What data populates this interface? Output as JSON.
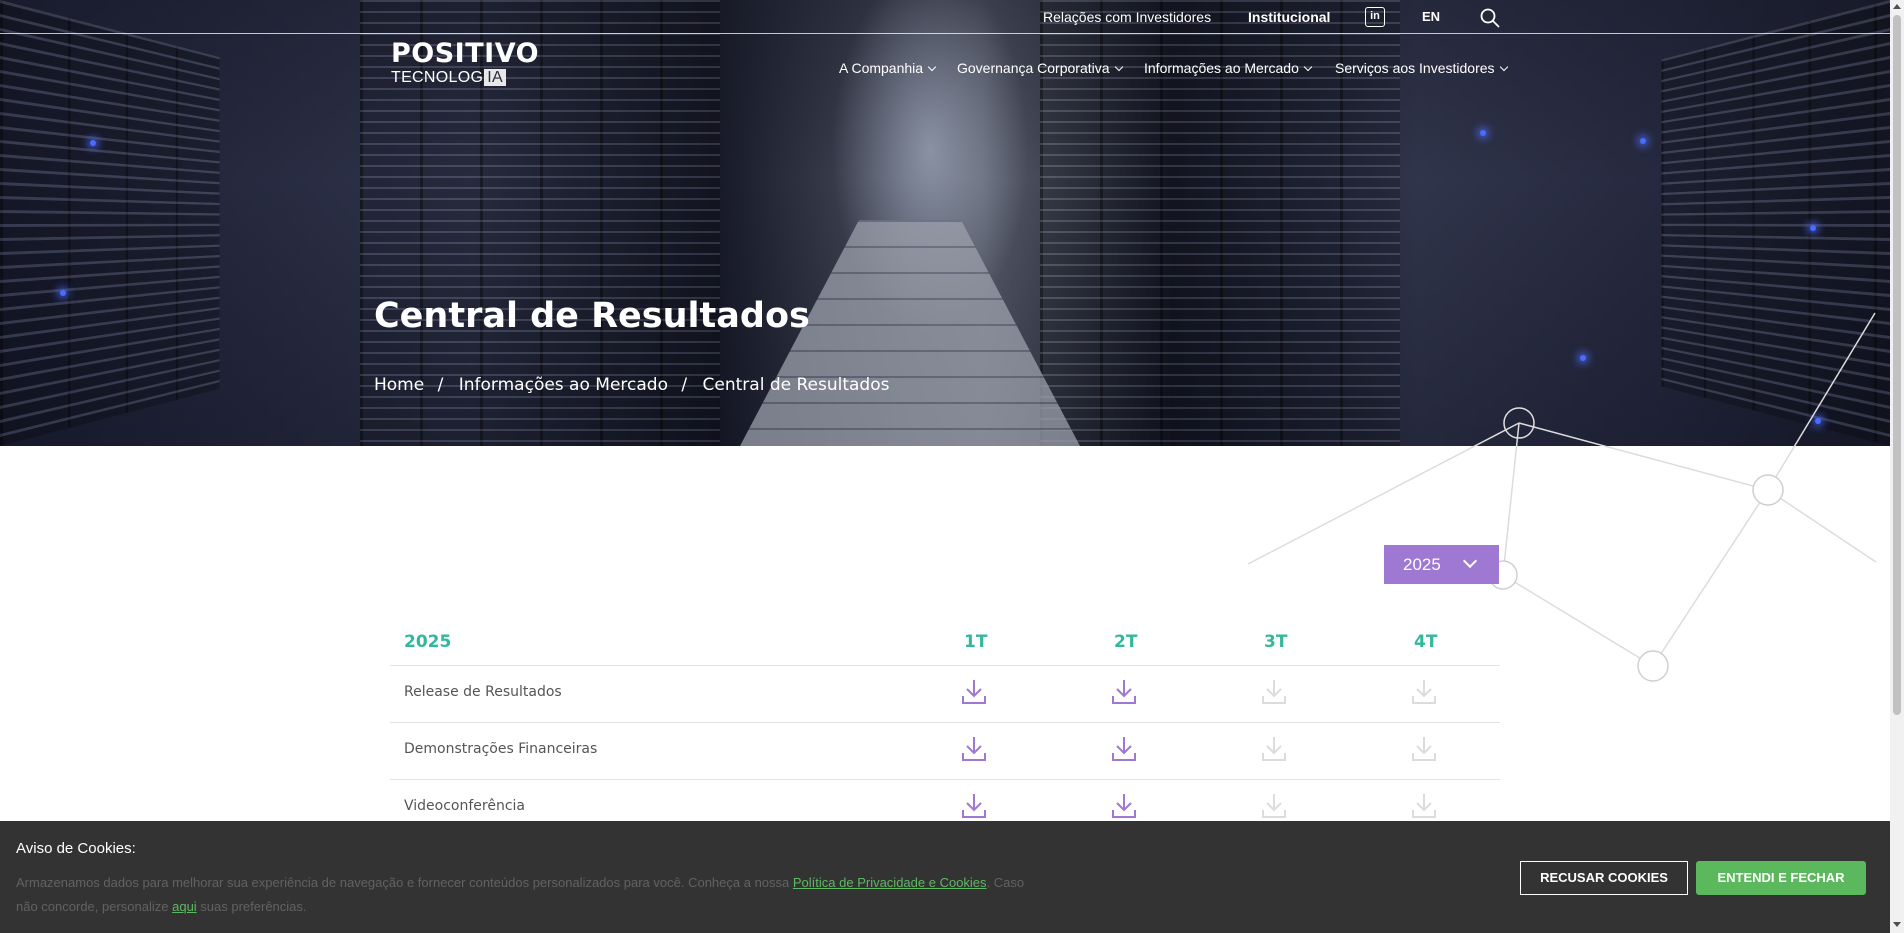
{
  "topbar": {
    "investor_relations": "Relações com Investidores",
    "institutional": "Institucional",
    "linkedin": "in",
    "language": "EN"
  },
  "logo": {
    "line1": "POSITIVO",
    "line2": "TECNOLOG",
    "line2_badge": "IA"
  },
  "nav": {
    "items": [
      {
        "label": "A Companhia"
      },
      {
        "label": "Governança Corporativa"
      },
      {
        "label": "Informações ao Mercado"
      },
      {
        "label": "Serviços aos Investidores"
      }
    ]
  },
  "page": {
    "title": "Central de Resultados",
    "breadcrumb": [
      "Home",
      "Informações ao Mercado",
      "Central de Resultados"
    ],
    "breadcrumb_sep": "/"
  },
  "year_select": {
    "value": "2025"
  },
  "table": {
    "year_header": "2025",
    "quarters": [
      "1T",
      "2T",
      "3T",
      "4T"
    ],
    "rows": [
      {
        "label": "Release de Resultados",
        "available": [
          true,
          true,
          false,
          false
        ]
      },
      {
        "label": "Demonstrações Financeiras",
        "available": [
          true,
          true,
          false,
          false
        ]
      },
      {
        "label": "Videoconferência",
        "available": [
          true,
          true,
          false,
          false
        ]
      }
    ]
  },
  "cookie": {
    "title": "Aviso de Cookies:",
    "text_before": "Armazenamos dados para melhorar sua experiência de navegação e fornecer conteúdos personalizados para você. Conheça a nossa ",
    "policy_link": "Política de Privacidade e Cookies",
    "text_middle": ". Caso não concorde, personalize ",
    "here_link": "aqui",
    "text_after": " suas preferências.",
    "refuse_label": "RECUSAR COOKIES",
    "accept_label": "ENTENDI E FECHAR"
  },
  "colors": {
    "accent_purple": "#9e78d2",
    "accent_teal": "#33b89c",
    "accept_green": "#5cb85c",
    "disabled_icon": "#dcdcdc"
  },
  "icons": [
    "linkedin-icon",
    "search-icon",
    "chevron-down-icon",
    "download-icon"
  ]
}
